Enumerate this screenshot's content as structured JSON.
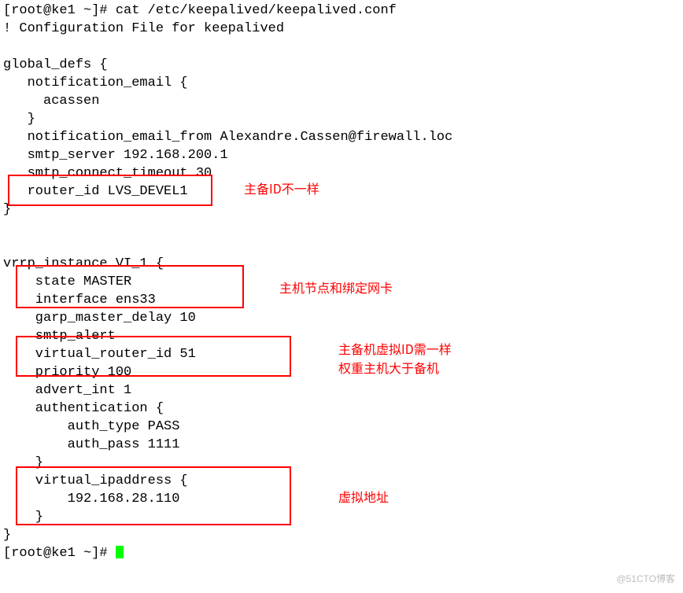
{
  "terminal": {
    "l0": "[root@ke1 ~]# cat /etc/keepalived/keepalived.conf",
    "l1": "! Configuration File for keepalived",
    "l2": "",
    "l3": "global_defs {",
    "l4": "   notification_email {",
    "l5": "     acassen",
    "l6": "   }",
    "l7": "   notification_email_from Alexandre.Cassen@firewall.loc",
    "l8": "   smtp_server 192.168.200.1",
    "l9": "   smtp_connect_timeout 30",
    "l10": "   router_id LVS_DEVEL1",
    "l11": "}",
    "l12": "",
    "l13": "",
    "l14": "vrrp_instance VI_1 {",
    "l15": "    state MASTER",
    "l16": "    interface ens33",
    "l17": "    garp_master_delay 10",
    "l18": "    smtp_alert",
    "l19": "    virtual_router_id 51",
    "l20": "    priority 100",
    "l21": "    advert_int 1",
    "l22": "    authentication {",
    "l23": "        auth_type PASS",
    "l24": "        auth_pass 1111",
    "l25": "    }",
    "l26": "    virtual_ipaddress {",
    "l27": "        192.168.28.110",
    "l28": "    }",
    "l29": "}",
    "l30": "[root@ke1 ~]# "
  },
  "annotations": {
    "a1": "主备ID不一样",
    "a2": "主机节点和绑定网卡",
    "a3a": "主备机虚拟ID需一样",
    "a3b": "权重主机大于备机",
    "a4": "虚拟地址"
  },
  "watermark": "@51CTO博客"
}
